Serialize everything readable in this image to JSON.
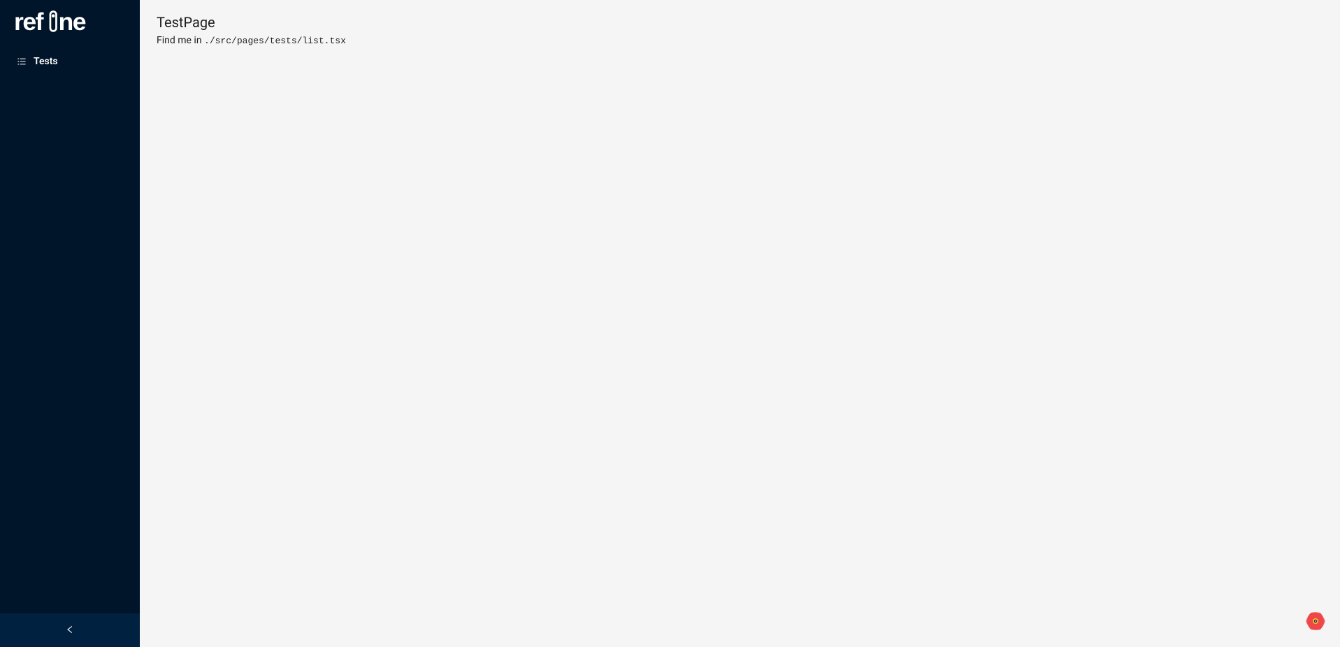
{
  "sidebar": {
    "logo_text": "refine",
    "items": [
      {
        "label": "Tests",
        "icon": "list-icon"
      }
    ]
  },
  "main": {
    "title": "TestPage",
    "description_prefix": "Find me in ",
    "description_path": "./src/pages/tests/list.tsx"
  }
}
